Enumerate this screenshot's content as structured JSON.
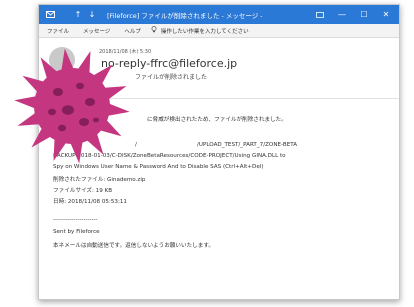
{
  "titlebar": {
    "title": "[Fileforce] ファイルが削除されました - メッセージ -",
    "undo": "↑",
    "redo": "↓",
    "minimize": "—",
    "maximize": "☐",
    "close": "✕"
  },
  "menubar": {
    "items": [
      "ファイル",
      "メッセージ",
      "ヘルプ"
    ],
    "tell_me": "操作したい作業を入力してください"
  },
  "header": {
    "date": "2018/11/08 (木) 5:30",
    "sender": "no-reply-ffrc@fileforce.jp",
    "subject": "ファイルが削除されました"
  },
  "body": {
    "line1": "に脅威が検出されたため、ファイルが削除されました。",
    "line2_a": "/",
    "line2_b": "/UPLOAD_TEST/_PART_7/ZONE-BETA",
    "line3": "BACKUP-2018-01-03/C-DISK/ZoneBetaResources/CODE-PROJECT/Using GINA.DLL to",
    "line4": "Spy on Windows User Name & Password And to Disable SAS (Ctrl+Alt+Del)",
    "line5": "削除されたファイル: Ginademo.zip",
    "line6": "ファイルサイズ: 19 KB",
    "line7": "日時: 2018/11/08 05:53:11",
    "separator": "----------------------",
    "signature": "Sent by Fileforce",
    "footer": "本ネメールは自動送信です。返信しないようお願いいたします。"
  },
  "colors": {
    "titlebar": "#2b79d7",
    "virus": "#c4367f",
    "virus_spot": "#7a1a52"
  },
  "icons": [
    "mail-icon",
    "undo-icon",
    "redo-icon",
    "lightbulb-icon",
    "virus-icon"
  ]
}
